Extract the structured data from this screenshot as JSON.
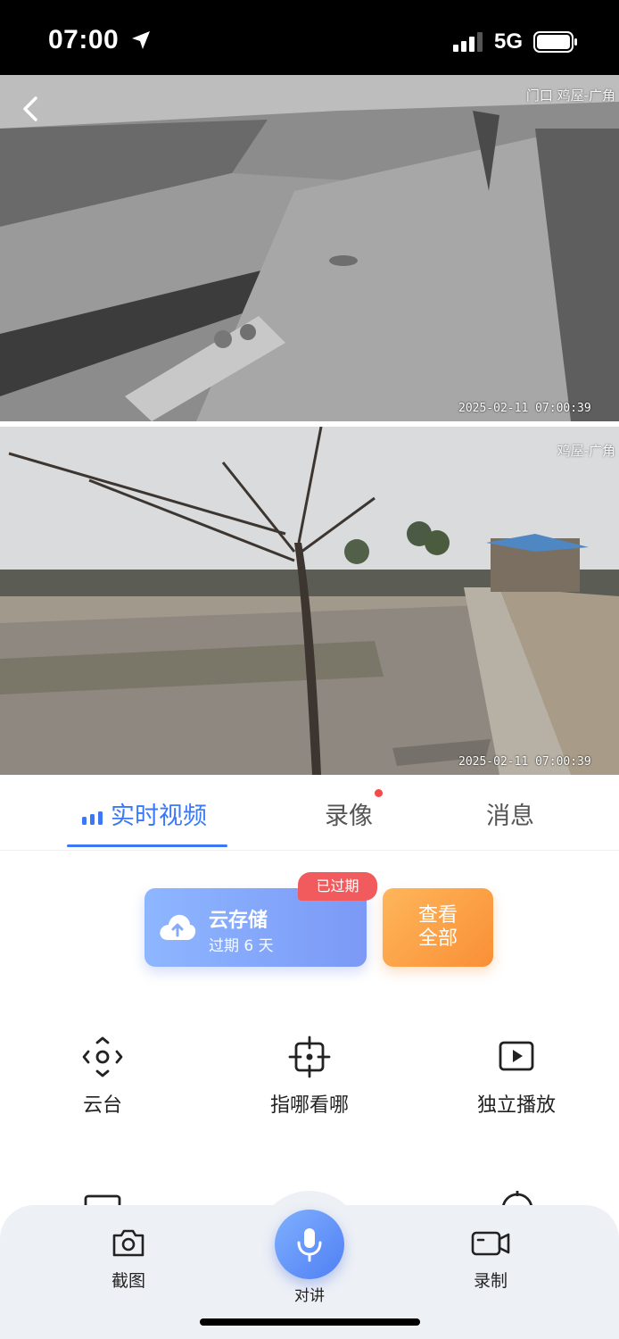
{
  "status": {
    "time": "07:00",
    "network": "5G"
  },
  "cameras": [
    {
      "label": "门口  鸡屋-广角",
      "timestamp": "2025-02-11 07:00:39"
    },
    {
      "label": "鸡屋-广角",
      "timestamp": "2025-02-11 07:00:39"
    }
  ],
  "tabs": [
    {
      "label": "实时视频",
      "active": true
    },
    {
      "label": "录像",
      "has_dot": true
    },
    {
      "label": "消息"
    }
  ],
  "cloud": {
    "title": "云存储",
    "subtitle": "过期 6 天",
    "badge": "已过期",
    "view_all_line1": "查看",
    "view_all_line2": "全部"
  },
  "features": [
    {
      "label": "云台",
      "icon": "ptz-icon"
    },
    {
      "label": "指哪看哪",
      "icon": "crosshair-icon"
    },
    {
      "label": "独立播放",
      "icon": "play-icon"
    }
  ],
  "bottom_bar": {
    "screenshot": "截图",
    "talk": "对讲",
    "record": "录制"
  },
  "colors": {
    "accent": "#3a79f6",
    "badge_red": "#f25b5d",
    "orange": "#f98f36"
  }
}
